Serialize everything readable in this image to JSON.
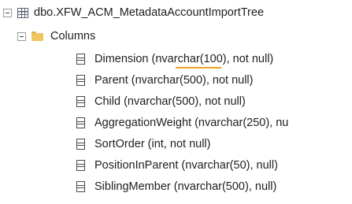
{
  "tree": {
    "table": {
      "label": "dbo.XFW_ACM_MetadataAccountImportTree"
    },
    "folder": {
      "label": "Columns"
    },
    "columns": [
      {
        "label": "Dimension (nvarchar(100), not null)"
      },
      {
        "label": "Parent (nvarchar(500), not null)"
      },
      {
        "label": "Child (nvarchar(500), not null)"
      },
      {
        "label": "AggregationWeight (nvarchar(250), nu"
      },
      {
        "label": "SortOrder (int, not null)"
      },
      {
        "label": "PositionInParent (nvarchar(50), null)"
      },
      {
        "label": "SiblingMember (nvarchar(500), null)"
      }
    ]
  },
  "highlight": {
    "color": "#f0a020"
  }
}
